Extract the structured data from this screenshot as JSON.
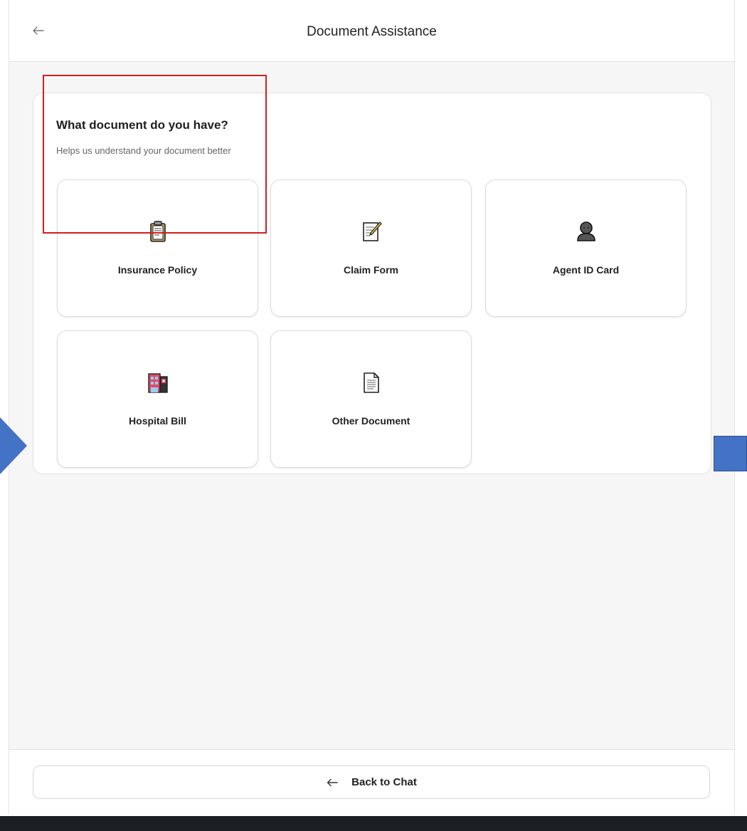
{
  "header": {
    "title": "Document Assistance",
    "back_icon": "arrow-left-icon"
  },
  "main": {
    "question": "What document do you have?",
    "subtitle": "Helps us understand your document better",
    "options": [
      {
        "label": "Insurance Policy",
        "icon": "clipboard-icon",
        "selected": true
      },
      {
        "label": "Claim Form",
        "icon": "memo-pencil-icon",
        "selected": false
      },
      {
        "label": "Agent ID Card",
        "icon": "person-bust-icon",
        "selected": false
      },
      {
        "label": "Hospital Bill",
        "icon": "hospital-icon",
        "selected": false
      },
      {
        "label": "Other Document",
        "icon": "page-icon",
        "selected": false
      }
    ]
  },
  "footer": {
    "back_label": "Back to Chat",
    "back_icon": "arrow-left-icon"
  },
  "colors": {
    "highlight": "#d01f1f",
    "annotation": "#4472c4"
  }
}
